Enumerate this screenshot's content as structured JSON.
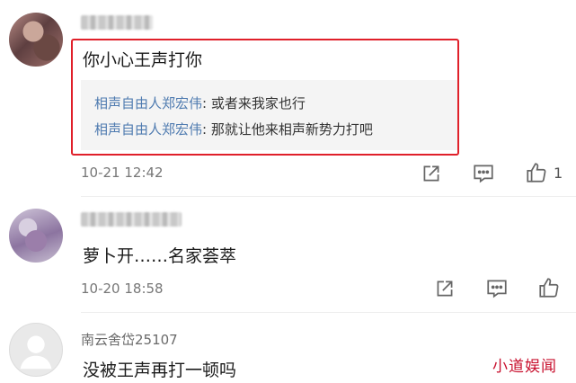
{
  "comments": [
    {
      "username": "",
      "text": "你小心王声打你",
      "replies": [
        {
          "author": "相声自由人郑宏伟",
          "sep": ": ",
          "text": "或者来我家也行"
        },
        {
          "author": "相声自由人郑宏伟",
          "sep": ": ",
          "text": "那就让他来相声新势力打吧"
        }
      ],
      "time": "10-21 12:42",
      "like_count": "1"
    },
    {
      "username": "",
      "text": "萝卜开……名家荟萃",
      "time": "10-20 18:58",
      "like_count": ""
    },
    {
      "username": "南云舍岱25107",
      "text": "没被王声再打一顿吗"
    }
  ],
  "watermark": "小道娱闻",
  "icons": [
    "share-icon",
    "reply-icon",
    "like-icon",
    "default-avatar-icon"
  ],
  "colors": {
    "highlight": "#e0202a",
    "reply_author": "#4f7bb0",
    "watermark": "#c8102e"
  }
}
